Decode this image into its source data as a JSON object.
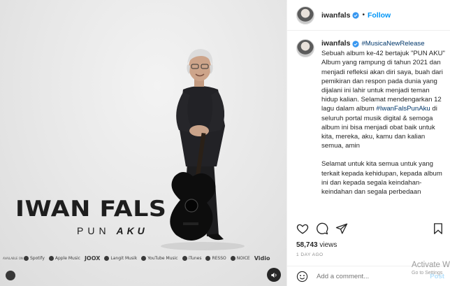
{
  "media": {
    "brand_name": "IWAN FALS",
    "album_word1": "PUN",
    "album_word2": "AKU",
    "platforms_caption": "AVAILABLE ON",
    "platforms": [
      "Spotify",
      "Apple Music",
      "JOOX",
      "Langit Musik",
      "YouTube Music",
      "iTunes",
      "RESSO",
      "NOICE",
      "Vidio"
    ]
  },
  "header": {
    "username": "iwanfals",
    "separator": "•",
    "follow_label": "Follow"
  },
  "caption": {
    "username": "iwanfals",
    "hashtag_top": "#MusicaNewRelease",
    "para1_a": "Sebuah album ke-42 bertajuk \"PUN AKU\" Album yang rampung di tahun 2021 dan menjadi refleksi akan diri saya, buah dari pemikiran dan respon pada dunia yang dijalani ini lahir untuk menjadi teman hidup kalian. Selamat mendengarkan 12 lagu dalam album ",
    "hashtag_mid": "#IwanFalsPunAku",
    "para1_b": " di seluruh portal musik digital & semoga album ini bisa menjadi obat baik untuk kita, mereka, aku, kamu dan kalian semua, amin",
    "para2": "Selamat untuk kita semua untuk yang terkait kepada kehidupan, kepada album ini dan kepada segala keindahan-keindahan dan segala perbedaan"
  },
  "stats": {
    "views_count": "58,743",
    "views_label": "views",
    "time_ago": "1 DAY AGO"
  },
  "comment": {
    "placeholder": "Add a comment...",
    "post_label": "Post"
  },
  "watermark": {
    "line1": "Activate W",
    "line2": "Go to Settings"
  },
  "colors": {
    "accent": "#0095f6",
    "link": "#00376b",
    "verified": "#3897f0"
  }
}
